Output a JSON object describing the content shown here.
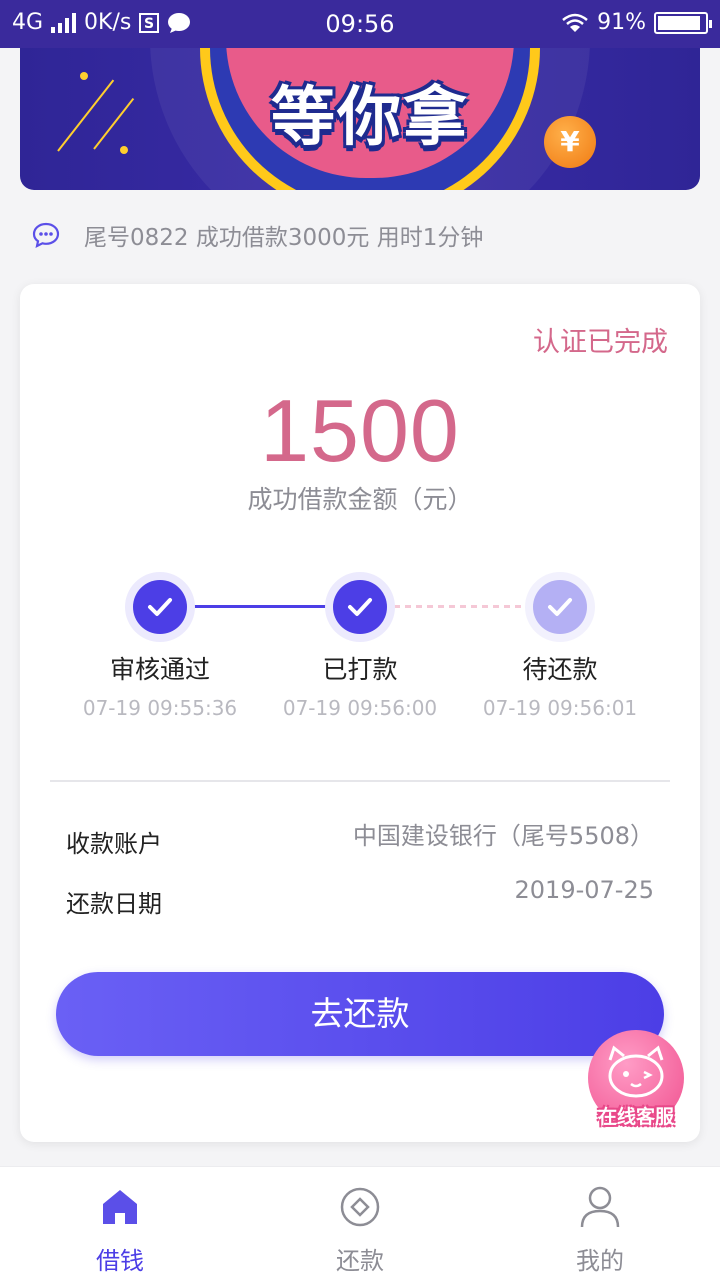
{
  "status_bar": {
    "network": "4G",
    "speed": "0K/s",
    "time": "09:56",
    "battery": "91%",
    "battery_level": 0.91
  },
  "banner": {
    "slogan": "等你拿",
    "coin_symbol": "¥"
  },
  "notice": {
    "text": "尾号0822 成功借款3000元 用时1分钟"
  },
  "loan_card": {
    "auth_status": "认证已完成",
    "amount": "1500",
    "amount_label": "成功借款金额（元）",
    "steps": [
      {
        "title": "审核通过",
        "time": "07-19 09:55:36",
        "done": true
      },
      {
        "title": "已打款",
        "time": "07-19 09:56:00",
        "done": true
      },
      {
        "title": "待还款",
        "time": "07-19 09:56:01",
        "done": false
      }
    ],
    "info": [
      {
        "key": "收款账户",
        "value": "中国建设银行（尾号5508）"
      },
      {
        "key": "还款日期",
        "value": "2019-07-25"
      }
    ],
    "repay_button": "去还款"
  },
  "service_widget": {
    "label": "在线客服"
  },
  "bottom_nav": {
    "items": [
      {
        "label": "借钱",
        "icon": "home-icon",
        "active": true
      },
      {
        "label": "还款",
        "icon": "repay-icon",
        "active": false
      },
      {
        "label": "我的",
        "icon": "profile-icon",
        "active": false
      }
    ]
  },
  "colors": {
    "accent": "#4c3ee6",
    "pink": "#d4688b",
    "muted": "#8d8d95",
    "step_pending": "#b4b0f4"
  }
}
